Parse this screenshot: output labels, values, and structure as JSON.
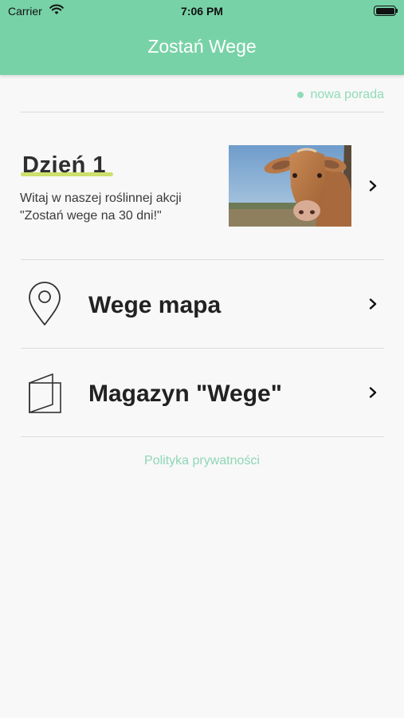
{
  "status_bar": {
    "carrier": "Carrier",
    "time": "7:06 PM"
  },
  "header": {
    "title": "Zostań Wege",
    "background_color": "#78d2a7"
  },
  "new_tip": {
    "label": "nowa porada",
    "color": "#8fdcb9"
  },
  "day_card": {
    "title": "Dzień 1",
    "description_line1": "Witaj w naszej roślinnej akcji",
    "description_line2": "\"Zostań wege na 30 dni!\"",
    "image_icon": "cow-photo",
    "chevron_icon": "chevron-right-icon"
  },
  "menu": [
    {
      "label": "Wege mapa",
      "icon": "map-pin-icon"
    },
    {
      "label": "Magazyn \"Wege\"",
      "icon": "magazine-icon"
    }
  ],
  "footer": {
    "privacy_link": "Polityka prywatności"
  }
}
